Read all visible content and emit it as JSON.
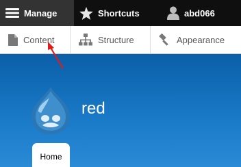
{
  "toolbar": {
    "manage_label": "Manage",
    "shortcuts_label": "Shortcuts",
    "user_label": "abd066"
  },
  "tray": {
    "content_label": "Content",
    "structure_label": "Structure",
    "appearance_label": "Appearance"
  },
  "site": {
    "name": "red",
    "home_tab_label": "Home"
  },
  "colors": {
    "toolbar_bg": "#0f0f0f",
    "manage_active_bg": "#333333",
    "tray_bg": "#ffffff",
    "header_blue": "#1a7bc9",
    "annotation_red": "#e01b1b"
  },
  "icons": {
    "manage": "hamburger-icon",
    "shortcuts": "star-icon",
    "user": "user-icon",
    "content": "document-icon",
    "structure": "sitemap-icon",
    "appearance": "paint-brush-icon",
    "logo": "drupal-drop-logo"
  }
}
